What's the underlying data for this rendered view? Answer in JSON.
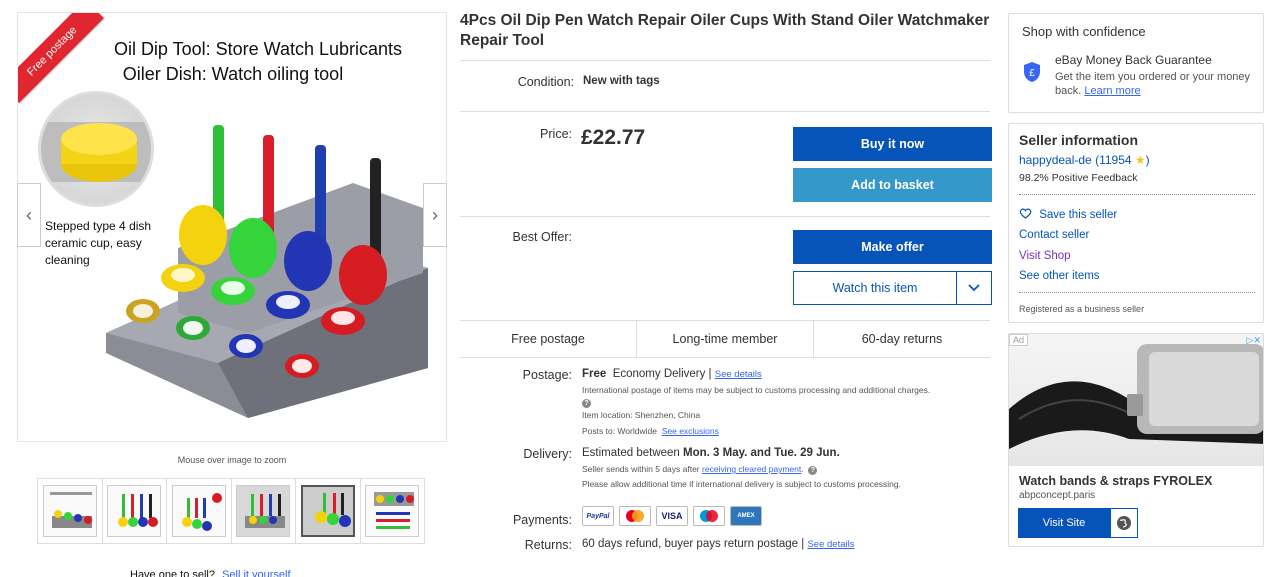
{
  "gallery": {
    "ribbon": "Free postage",
    "hero_line1": "Oil Dip Tool: Store Watch Lubricants",
    "hero_line2": "Oiler Dish: Watch oiling tool",
    "caption": "Stepped type 4 dish ceramic cup, easy cleaning",
    "zoom_hint": "Mouse over image to zoom",
    "thumb_count": 6
  },
  "sell": {
    "question": "Have one to sell?",
    "link": "Sell it yourself"
  },
  "listing": {
    "title": "4Pcs Oil Dip Pen Watch Repair Oiler Cups With Stand Oiler Watchmaker Repair Tool",
    "condition_label": "Condition:",
    "condition_value": "New with tags",
    "price_label": "Price:",
    "price_value": "£22.77",
    "best_offer_label": "Best Offer:",
    "buy_now": "Buy it now",
    "add_basket": "Add to basket",
    "make_offer": "Make offer",
    "watch": "Watch this item"
  },
  "badges": [
    "Free postage",
    "Long-time member",
    "60-day returns"
  ],
  "details": {
    "postage_label": "Postage:",
    "postage_free": "Free",
    "postage_service": "Economy Delivery |",
    "postage_link": "See details",
    "postage_intl": "International postage of items may be subject to customs processing and additional charges.",
    "item_location": "Item location:  Shenzhen, China",
    "posts_to": "Posts to:  Worldwide",
    "posts_to_link": "See exclusions",
    "delivery_label": "Delivery:",
    "delivery_prefix": "Estimated between",
    "delivery_dates": "Mon. 3 May. and Tue. 29 Jun.",
    "delivery_sends": "Seller sends within 5 days after",
    "delivery_sends_link": "receiving cleared payment",
    "delivery_note": "Please allow additional time if international delivery is subject to customs processing.",
    "payments_label": "Payments:",
    "payment_methods": [
      "PayPal",
      "MC",
      "VISA",
      "Maestro",
      "AMEX"
    ],
    "returns_label": "Returns:",
    "returns_value": "60 days refund, buyer pays return postage |",
    "returns_link": "See details"
  },
  "confidence": {
    "heading": "Shop with confidence",
    "guarantee_title": "eBay Money Back Guarantee",
    "guarantee_desc": "Get the item you ordered or your money back.",
    "learn_more": "Learn more"
  },
  "seller": {
    "heading": "Seller information",
    "name": "happydeal-de",
    "feedback_count": "(11954",
    "positive": "98.2% Positive Feedback",
    "save": "Save this seller",
    "contact": "Contact seller",
    "visit": "Visit Shop",
    "other": "See other items",
    "registered": "Registered as a business seller"
  },
  "ad": {
    "tag": "Ad",
    "title": "Watch bands & straps FYROLEX",
    "source": "abpconcept.paris",
    "button": "Visit Site"
  },
  "colors": {
    "primary_blue": "#0654ba",
    "light_blue": "#3498ca",
    "ribbon_red": "#e0262e"
  }
}
